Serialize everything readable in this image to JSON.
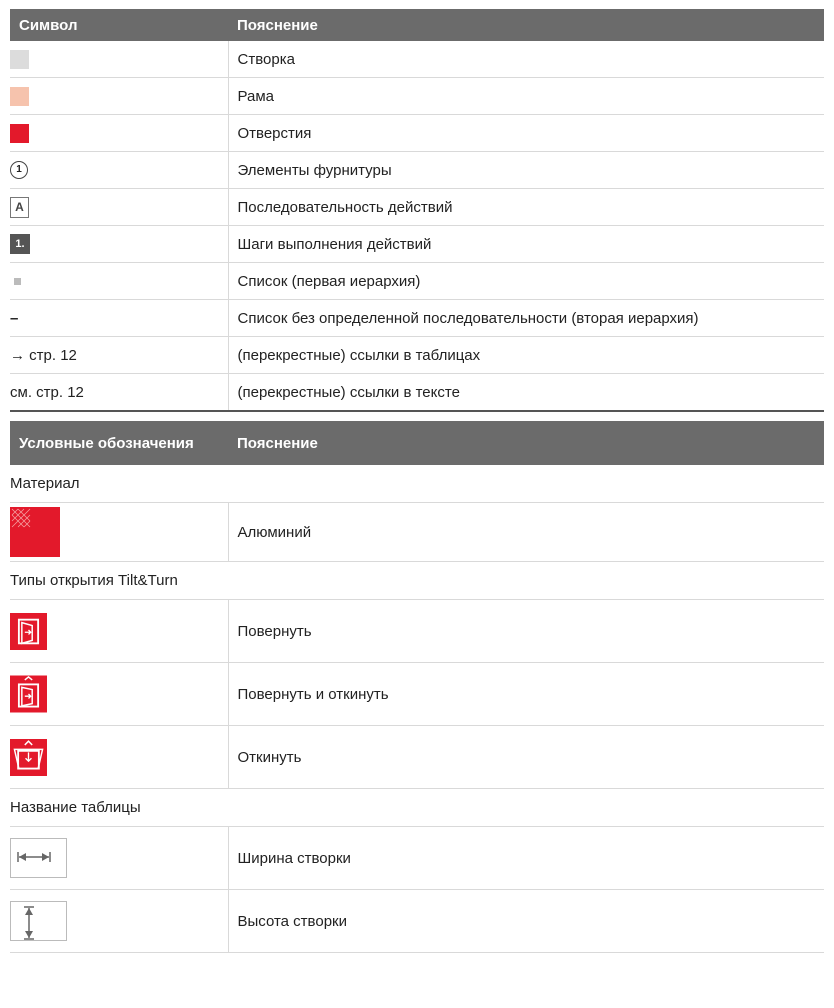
{
  "table1": {
    "header": [
      "Символ",
      "Пояснение"
    ],
    "rows": [
      {
        "symbol": "",
        "text": "Створка"
      },
      {
        "symbol": "",
        "text": "Рама"
      },
      {
        "symbol": "",
        "text": "Отверстия"
      },
      {
        "symbol": "1",
        "text": "Элементы фурнитуры"
      },
      {
        "symbol": "A",
        "text": "Последовательность действий"
      },
      {
        "symbol": "1.",
        "text": "Шаги выполнения действий"
      },
      {
        "symbol": "",
        "text": "Список (первая иерархия)"
      },
      {
        "symbol": "–",
        "text": "Список без определенной последовательности (вторая иерархия)"
      },
      {
        "symbol": "→ стр. 12",
        "text": "(перекрестные) ссылки в таблицах"
      },
      {
        "symbol": "см. стр. 12",
        "text": "(перекрестные) ссылки в тексте"
      }
    ]
  },
  "table2": {
    "header": [
      "Условные обозначения",
      "Пояснение"
    ],
    "sections": [
      {
        "title": "Материал",
        "rows": [
          {
            "text": "Алюминий"
          }
        ]
      },
      {
        "title": "Типы открытия Tilt&Turn",
        "rows": [
          {
            "text": "Повернуть"
          },
          {
            "text": "Повернуть и откинуть"
          },
          {
            "text": "Откинуть"
          }
        ]
      },
      {
        "title": "Название таблицы",
        "rows": [
          {
            "text": "Ширина створки"
          },
          {
            "text": "Высота створки"
          }
        ]
      }
    ]
  },
  "colors": {
    "sash": "#dcdcdc",
    "frame": "#f6c3ad",
    "holes": "#e3192b",
    "header": "#6b6b6b"
  },
  "icons": [
    "numbered-circle-icon",
    "letter-box-icon",
    "step-box-icon",
    "bullet-icon",
    "aluminium-material-icon",
    "turn-icon",
    "turn-tilt-icon",
    "tilt-icon",
    "width-dimension-icon",
    "height-dimension-icon"
  ]
}
